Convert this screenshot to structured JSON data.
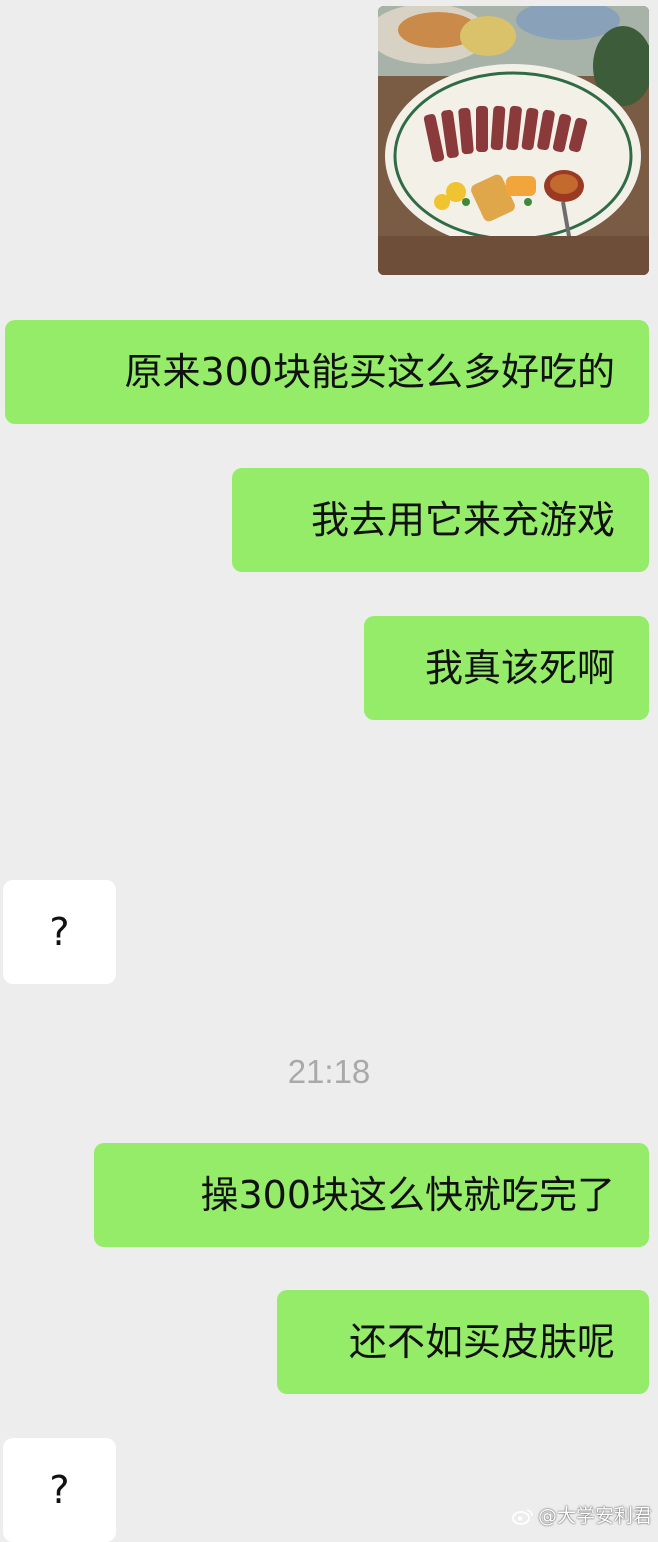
{
  "colors": {
    "background": "#ededed",
    "outgoing_bubble": "#95ec69",
    "incoming_bubble": "#ffffff",
    "timestamp_text": "#a9a9a9"
  },
  "photo": {
    "icon": "food-photo",
    "caption": ""
  },
  "messages": [
    {
      "from": "me",
      "text": "原来300块能买这么多好吃的"
    },
    {
      "from": "me",
      "text": "我去用它来充游戏"
    },
    {
      "from": "me",
      "text": "我真该死啊"
    },
    {
      "from": "them",
      "text": "?"
    },
    {
      "from": "me",
      "text": "操300块这么快就吃完了"
    },
    {
      "from": "me",
      "text": "还不如买皮肤呢"
    },
    {
      "from": "them",
      "text": "?"
    }
  ],
  "timestamp": "21:18",
  "watermark": {
    "icon": "weibo-logo",
    "text": "@大学安利君"
  }
}
